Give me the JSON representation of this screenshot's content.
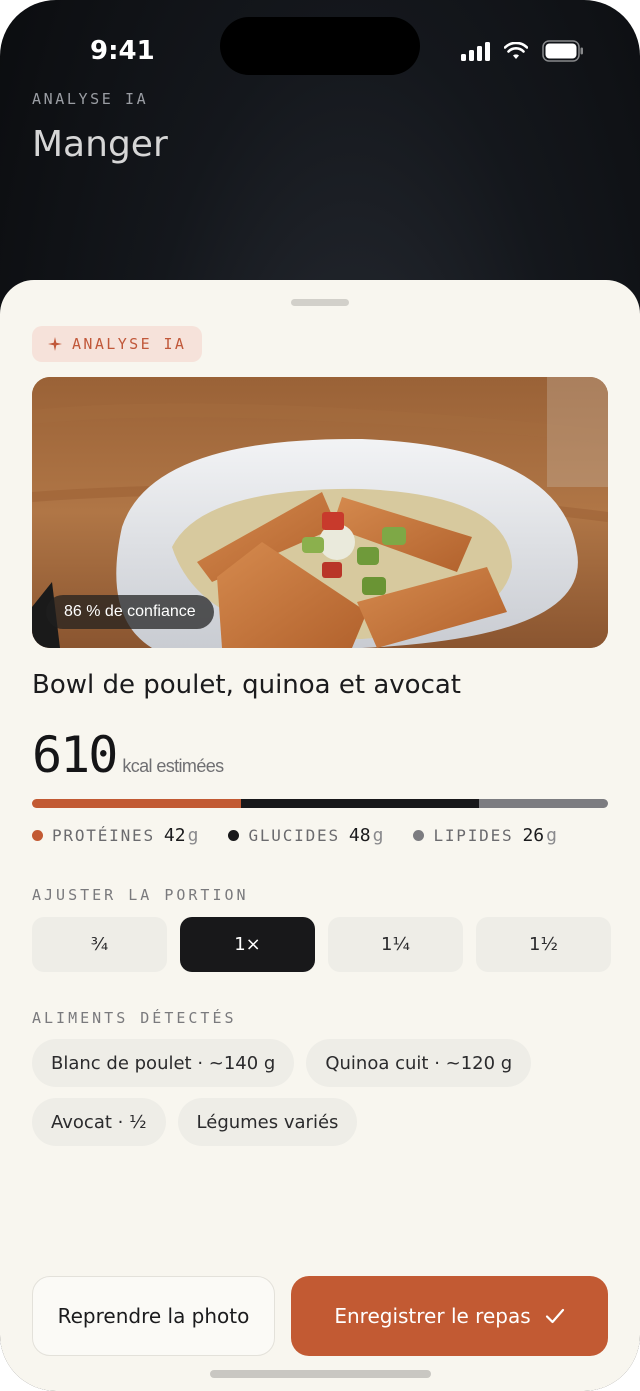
{
  "status_bar": {
    "time": "9:41"
  },
  "header": {
    "kicker": "ANALYSE IA",
    "title": "Manger"
  },
  "sheet": {
    "ai_badge": "ANALYSE IA",
    "photo": {
      "confidence": "86 % de confiance"
    },
    "dish_name": "Bowl de poulet, quinoa et avocat",
    "calories": {
      "value": "610",
      "label": "kcal estimées"
    },
    "macros": [
      {
        "name": "PROTÉINES",
        "value": "42",
        "unit": "g",
        "color": "#c25a33"
      },
      {
        "name": "GLUCIDES",
        "value": "48",
        "unit": "g",
        "color": "#18181a"
      },
      {
        "name": "LIPIDES",
        "value": "26",
        "unit": "g",
        "color": "#7c7c80"
      }
    ],
    "portion": {
      "label": "AJUSTER LA PORTION",
      "options": [
        "¾",
        "1×",
        "1¼",
        "1½"
      ],
      "selected": "1×"
    },
    "detected": {
      "label": "ALIMENTS DÉTECTÉS",
      "items": [
        "Blanc de poulet · ~140 g",
        "Quinoa cuit · ~120 g",
        "Avocat · ½",
        "Légumes variés"
      ]
    },
    "actions": {
      "retake": "Reprendre la photo",
      "save": "Enregistrer le repas"
    }
  },
  "colors": {
    "accent": "#c25a33",
    "sheet_bg": "#f8f6ef",
    "selected_bg": "#18181a"
  }
}
